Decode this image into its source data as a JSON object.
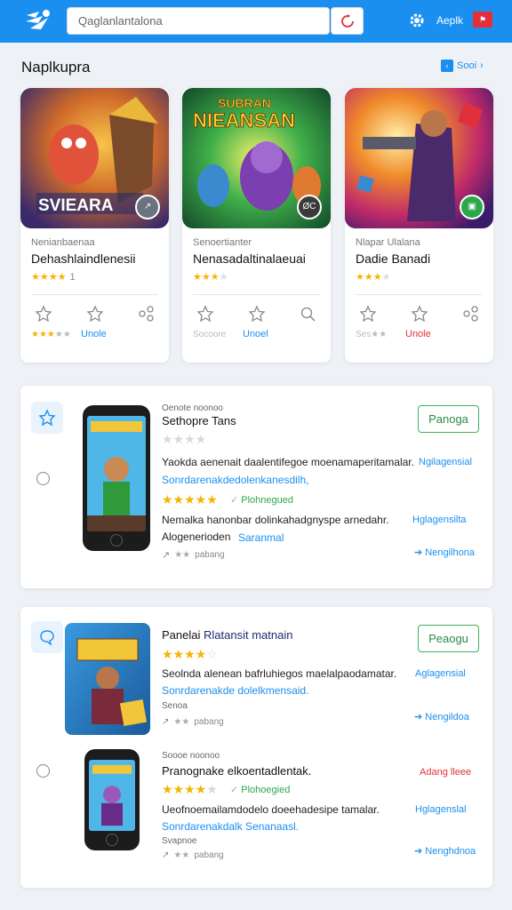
{
  "header": {
    "search_placeholder": "Qaglanlantalona",
    "user_label": "Aeplk",
    "flag_text": "⚑"
  },
  "section": {
    "title": "Naplkupra",
    "more_label": "Sooi",
    "more_icon": "‹"
  },
  "game_cards": [
    {
      "thumb_text": "SVIEARA",
      "subtitle": "Nenianbaenaa",
      "name": "Dehashlaindlenesii",
      "stars": "★★★★",
      "count": "1",
      "footer_stars": "★★★",
      "footer_grey": "★★",
      "footer_link": "Unole",
      "link_color": "#1a8ff0",
      "badge_color": "#6b7280"
    },
    {
      "thumb_text": "NIEANSAN",
      "thumb_text2": "SUBRAN",
      "subtitle": "Senoertianter",
      "name": "Nenasadaltinalaeuai",
      "stars": "★★★",
      "count": "",
      "footer_stars": "",
      "footer_grey": "Socoore",
      "footer_link": "Unoel",
      "link_color": "#1a8ff0",
      "badge_color": "#3a3a3a",
      "badge_text": "ØC"
    },
    {
      "thumb_text": "",
      "subtitle": "Nlapar Ulalana",
      "name": "Dadie Banadi",
      "stars": "★★★",
      "count": "",
      "footer_stars": "",
      "footer_grey": "Ses★★",
      "footer_link": "Unole",
      "link_color": "#e2303a",
      "badge_color": "#2ca84b",
      "badge_text": "▣"
    }
  ],
  "panel1": {
    "small": "Oenote noonoo",
    "title": "Sethopre Tans",
    "action": "Panoga",
    "line1": "Yaokda aenenait daalentifegoe moenamaperitamalar.",
    "line1_link": "Ngilagensial",
    "line2": "Sonrdarenakdedolenkanesdilh,",
    "badge": "Plohnegued",
    "line3": "Nemalka hanonbar dolinkahadgnyspe arnedahr.",
    "line3_link": "Hglagensilta",
    "line4": "Alogenerioden",
    "line4_link": "Saranmal",
    "meta": "pabang",
    "share": "Nengilhona"
  },
  "panel2": {
    "title": "Panelai",
    "title_blue": "Rlatansit matnain",
    "action": "Peaogu",
    "line1": "Seolnda alenean bafrluhiegos maelalpaodamatar.",
    "line1_link": "Aglagensial",
    "line2": "Sonrdarenakde dolelkmensaid.",
    "small1": "Senoa",
    "meta1": "pabang",
    "share1": "Nengildoa",
    "small2": "Soooe noonoo",
    "title2": "Pranognake elkoentadlentak.",
    "red_link": "Adang lleee",
    "badge2": "Plohoegied",
    "line3": "Ueofnoemailamdodelo doeehadesipe tamalar.",
    "line3_link": "Hglagenslal",
    "line4": "Sonrdarenakdalk Senanaasl.",
    "small3": "Svapnoe",
    "meta2": "pabang",
    "share2": "Nenghdnoa"
  }
}
